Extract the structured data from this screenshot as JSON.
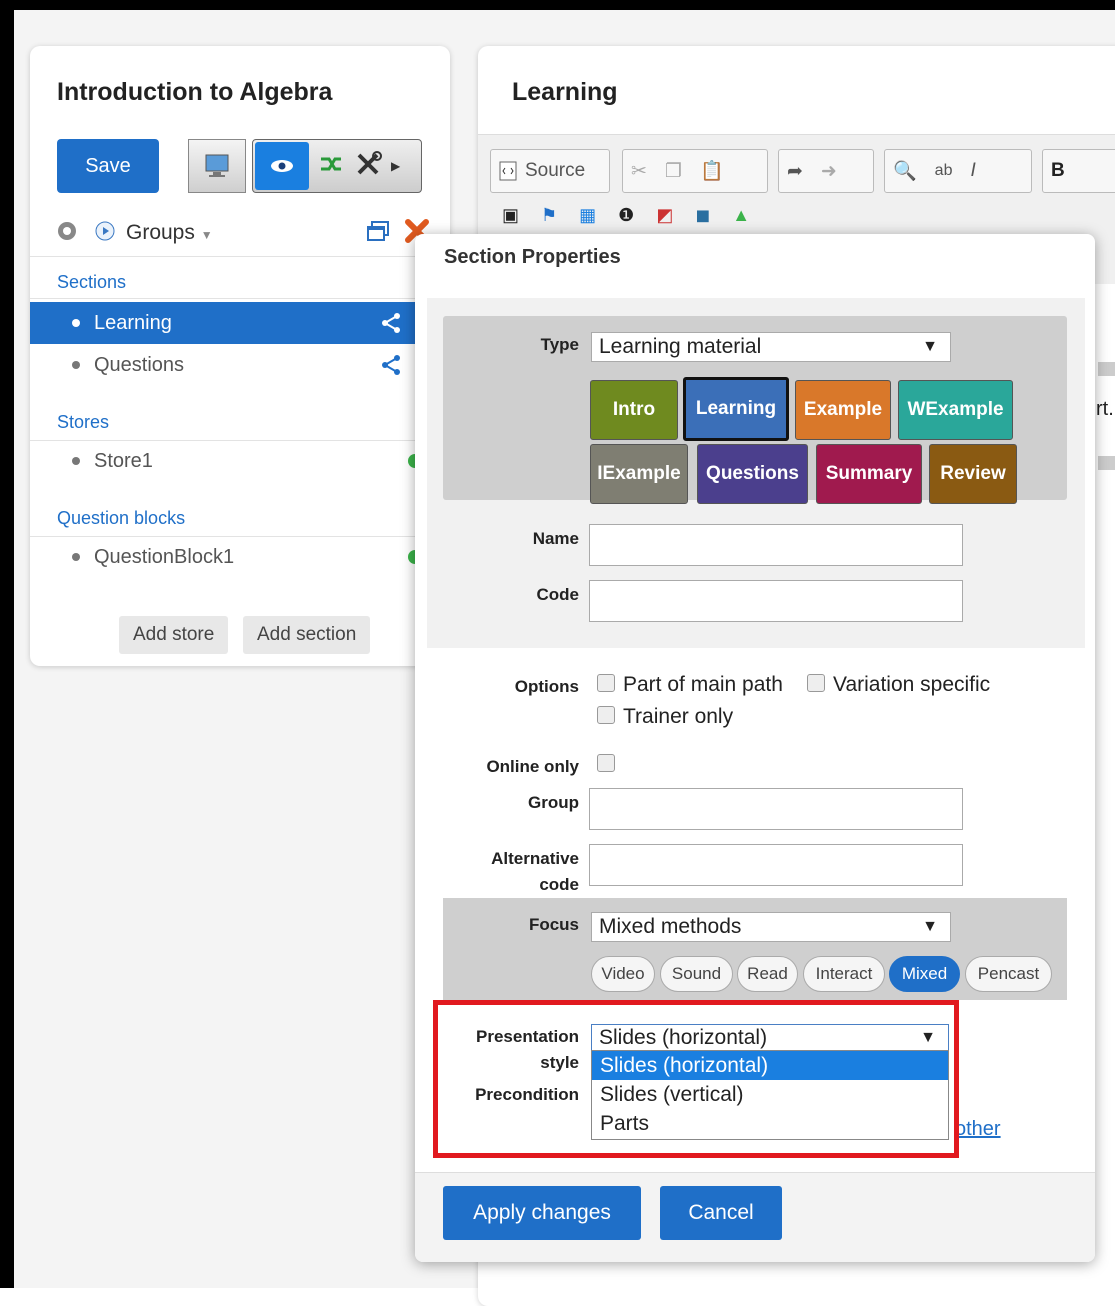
{
  "left_panel": {
    "title": "Introduction to Algebra",
    "save_label": "Save",
    "groups_label": "Groups",
    "sections_heading": "Sections",
    "sections": [
      {
        "label": "Learning",
        "active": true
      },
      {
        "label": "Questions",
        "active": false
      }
    ],
    "stores_heading": "Stores",
    "stores": [
      {
        "label": "Store1"
      }
    ],
    "qblocks_heading": "Question blocks",
    "qblocks": [
      {
        "label": "QuestionBlock1"
      }
    ],
    "add_store_label": "Add store",
    "add_section_label": "Add section"
  },
  "editor": {
    "title": "Learning",
    "source_label": "Source",
    "bold_label": "B",
    "side_text": "rt."
  },
  "dialog": {
    "title": "Section Properties",
    "type_label": "Type",
    "type_value": "Learning material",
    "type_buttons": [
      {
        "label": "Intro",
        "color": "#6f8a1f"
      },
      {
        "label": "Learning",
        "color": "#3b6fb8"
      },
      {
        "label": "Example",
        "color": "#d9782a"
      },
      {
        "label": "WExample",
        "color": "#2aa79a"
      },
      {
        "label": "IExample",
        "color": "#7f7e72"
      },
      {
        "label": "Questions",
        "color": "#4b3f8d"
      },
      {
        "label": "Summary",
        "color": "#a01a4e"
      },
      {
        "label": "Review",
        "color": "#8a5a12"
      }
    ],
    "name_label": "Name",
    "code_label": "Code",
    "options_label": "Options",
    "opt_main_path": "Part of main path",
    "opt_variation": "Variation specific",
    "opt_trainer": "Trainer only",
    "online_only_label": "Online only",
    "group_label": "Group",
    "alt_code_label_1": "Alternative",
    "alt_code_label_2": "code",
    "focus_label": "Focus",
    "focus_value": "Mixed methods",
    "focus_pills": [
      "Video",
      "Sound",
      "Read",
      "Interact",
      "Mixed",
      "Pencast"
    ],
    "presentation_label_1": "Presentation",
    "presentation_label_2": "style",
    "presentation_value": "Slides (horizontal)",
    "presentation_options": [
      "Slides (horizontal)",
      "Slides (vertical)",
      "Parts"
    ],
    "precondition_label": "Precondition",
    "other_link": "other",
    "apply_label": "Apply changes",
    "cancel_label": "Cancel"
  }
}
